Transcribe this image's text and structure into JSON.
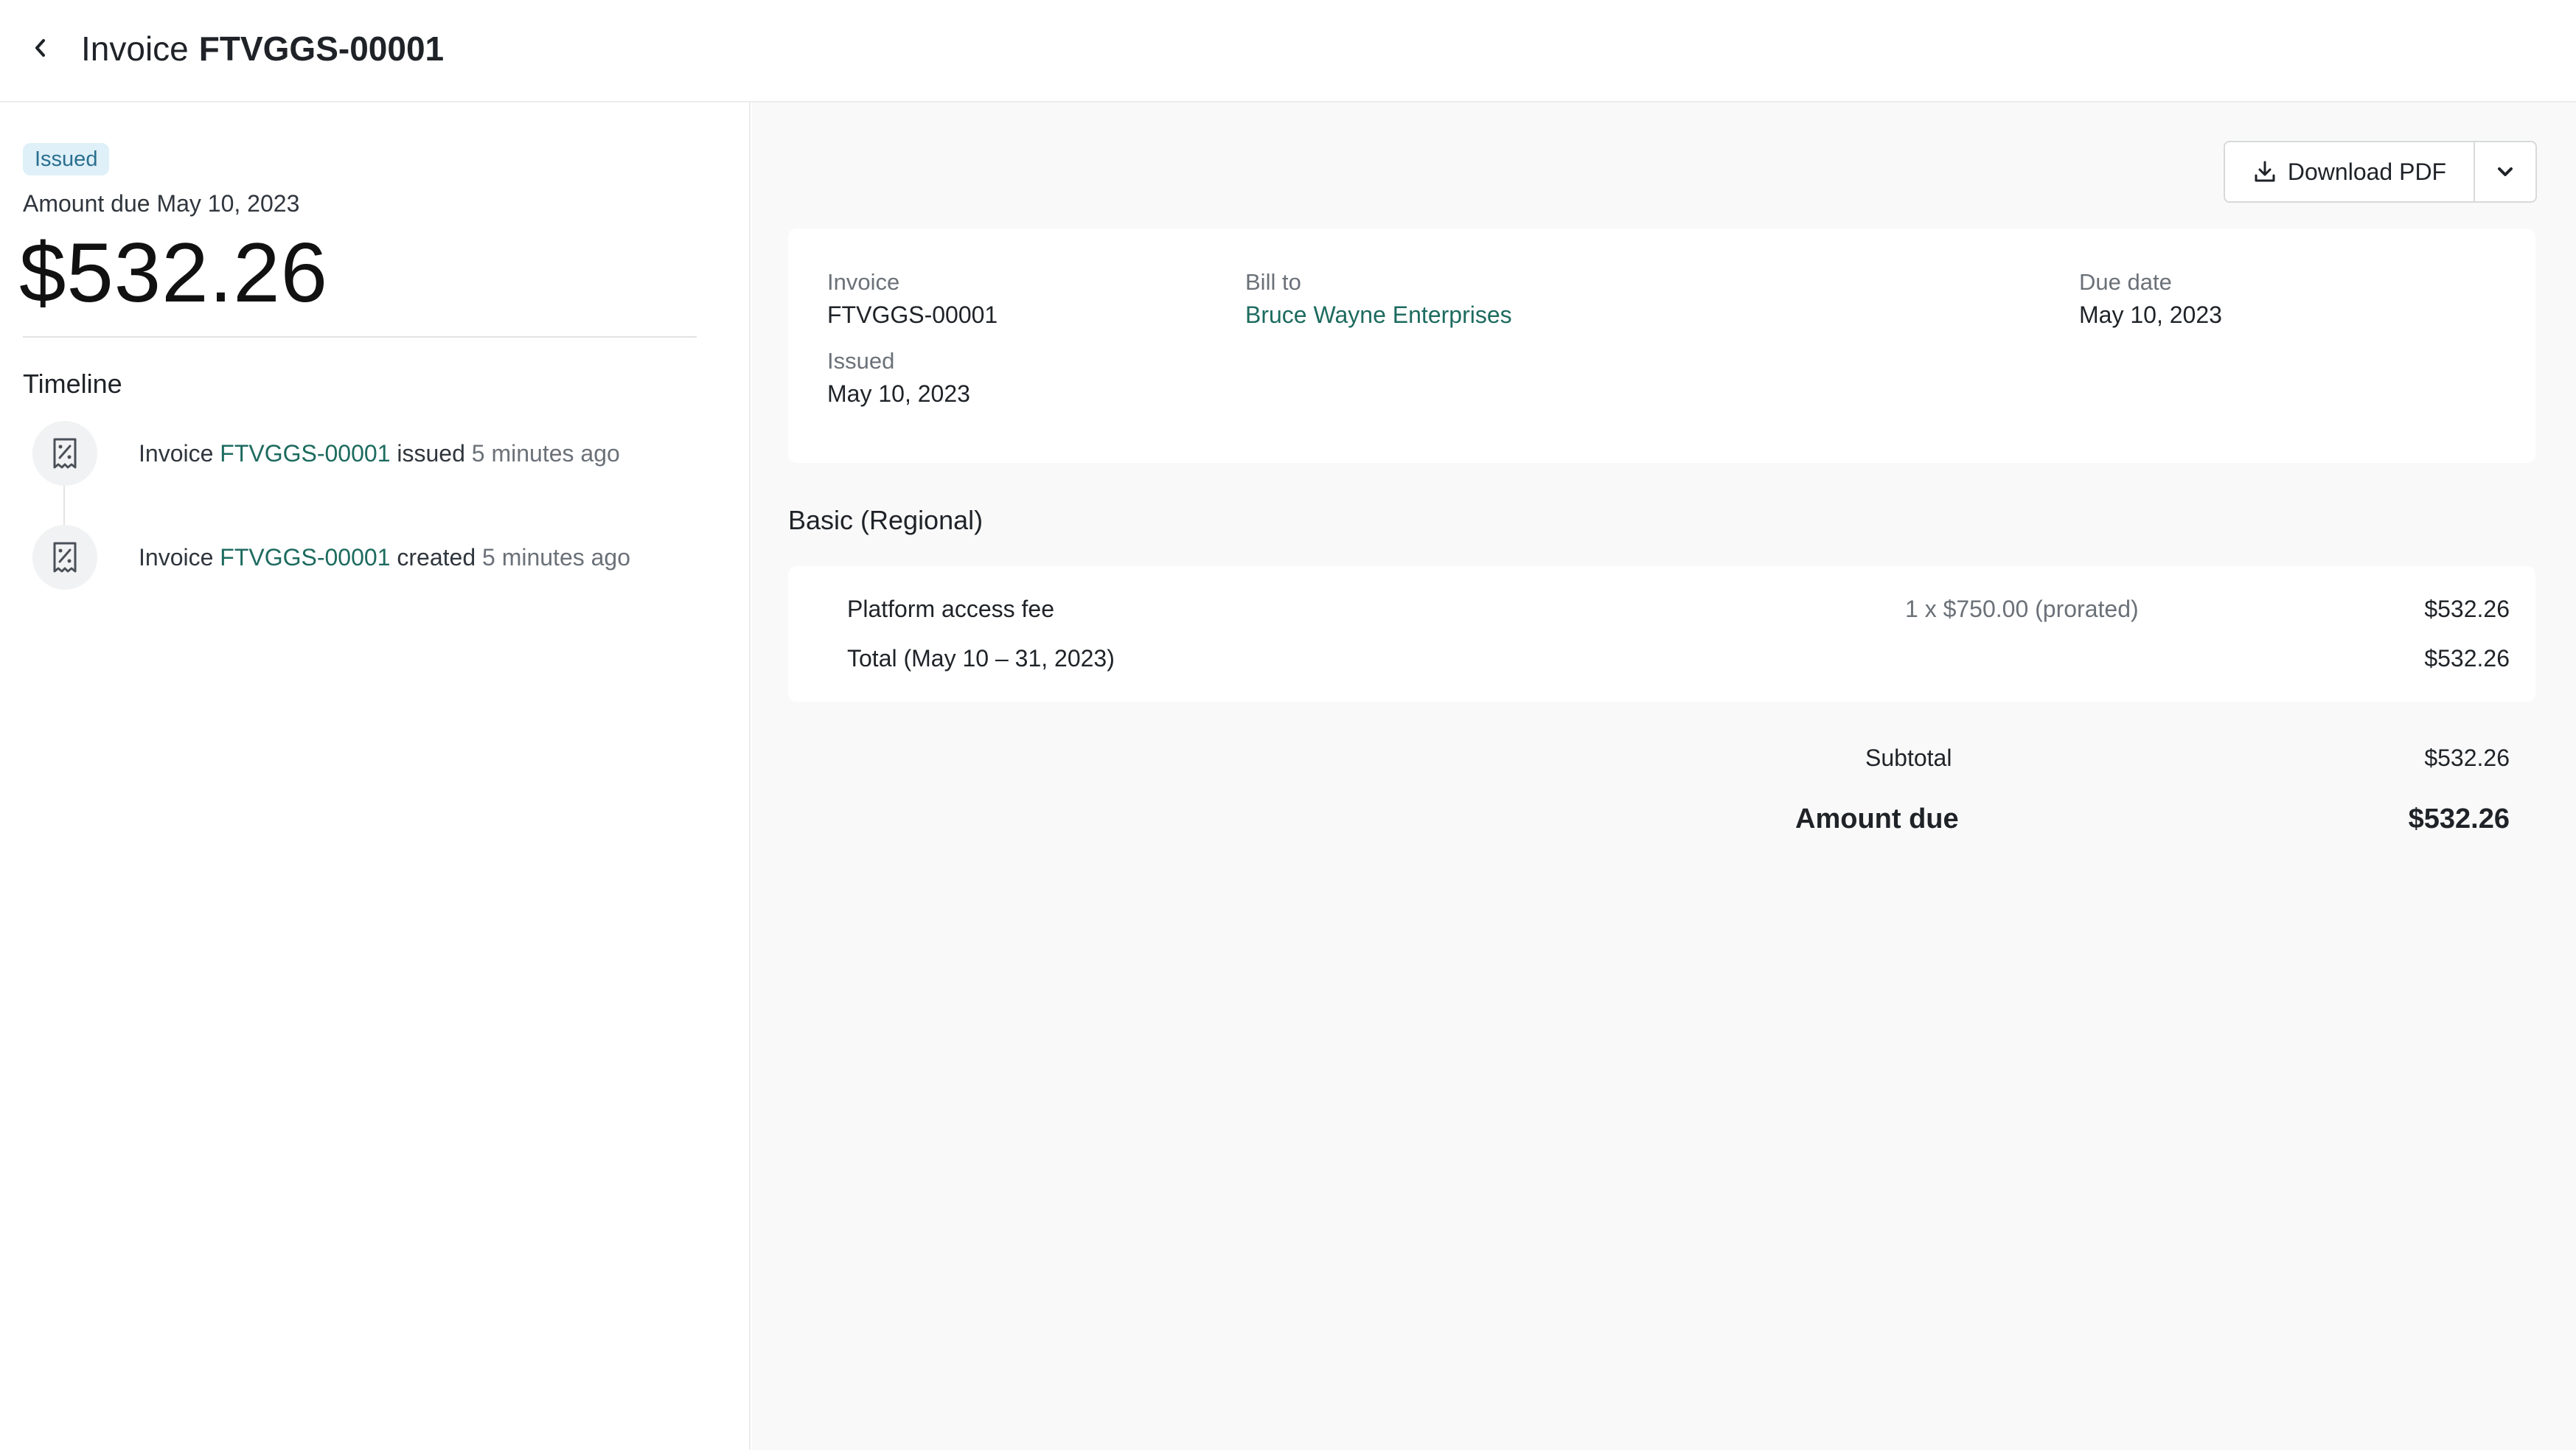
{
  "header": {
    "title_label": "Invoice",
    "invoice_number": "FTVGGS-00001"
  },
  "summary": {
    "status_badge": "Issued",
    "amount_due_label": "Amount due May 10, 2023",
    "amount": "$532.26"
  },
  "timeline": {
    "title": "Timeline",
    "events": [
      {
        "prefix": "Invoice",
        "link": "FTVGGS-00001",
        "action": "issued",
        "time": "5 minutes ago",
        "icon": "receipt-icon"
      },
      {
        "prefix": "Invoice",
        "link": "FTVGGS-00001",
        "action": "created",
        "time": "5 minutes ago",
        "icon": "receipt-icon"
      }
    ]
  },
  "actions": {
    "download_label": "Download PDF",
    "download_icon": "download-icon",
    "menu_icon": "chevron-down-icon"
  },
  "invoice_info": {
    "invoice_label": "Invoice",
    "invoice_value": "FTVGGS-00001",
    "issued_label": "Issued",
    "issued_value": "May 10, 2023",
    "bill_to_label": "Bill to",
    "bill_to_value": "Bruce Wayne Enterprises",
    "due_date_label": "Due date",
    "due_date_value": "May 10, 2023"
  },
  "plan": {
    "title": "Basic (Regional)",
    "lines": [
      {
        "description": "Platform access fee",
        "quantity": "1 x $750.00 (prorated)",
        "amount": "$532.26"
      },
      {
        "description": "Total (May 10 – 31, 2023)",
        "quantity": "",
        "amount": "$532.26"
      }
    ]
  },
  "totals": {
    "subtotal_label": "Subtotal",
    "subtotal_value": "$532.26",
    "amount_due_label": "Amount due",
    "amount_due_value": "$532.26"
  },
  "colors": {
    "link": "#1d6b5f",
    "badge_bg": "#dff0f8",
    "badge_text": "#2a6f8f",
    "panel_bg": "#f9f9f9"
  }
}
